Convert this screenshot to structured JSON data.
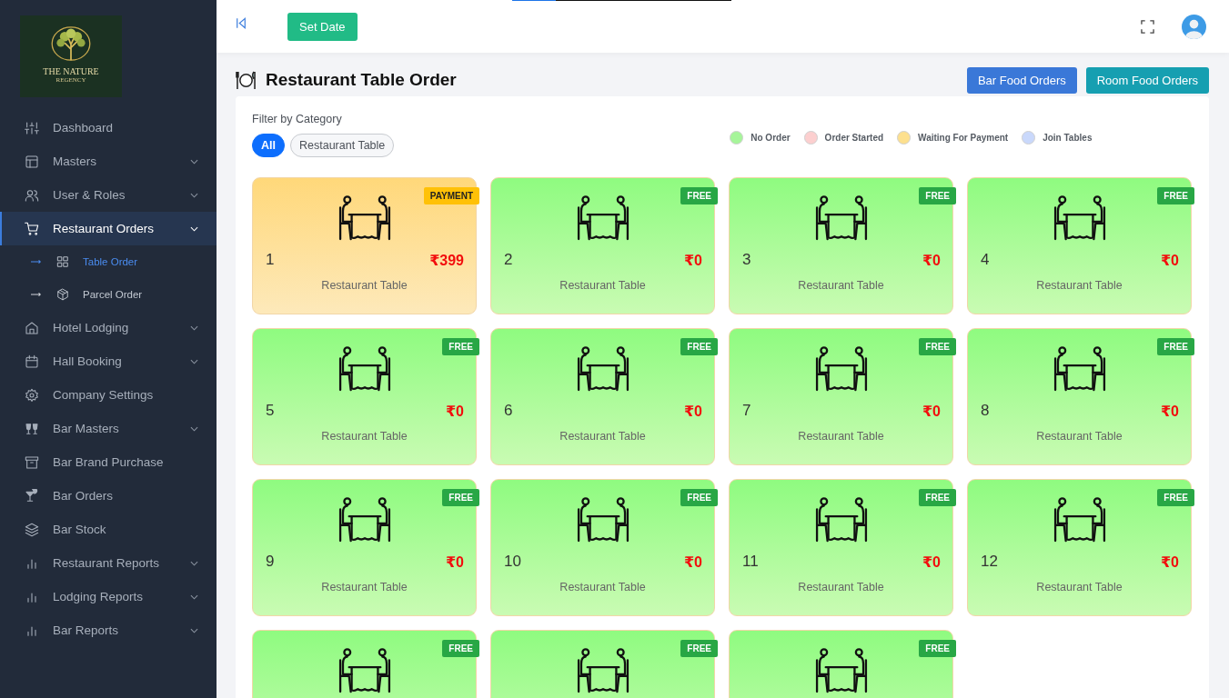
{
  "loading_bar": {
    "level": 0.2
  },
  "logo": {
    "name": "THE NATURE",
    "tagline": "REGENCY"
  },
  "sidebar": {
    "items": [
      {
        "label": "Dashboard",
        "expandable": false,
        "selected": false
      },
      {
        "label": "Masters",
        "expandable": true,
        "selected": false
      },
      {
        "label": "User & Roles",
        "expandable": true,
        "selected": false
      },
      {
        "label": "Restaurant Orders",
        "expandable": true,
        "selected": true,
        "children": [
          {
            "label": "Table Order",
            "selected": true
          },
          {
            "label": "Parcel Order",
            "selected": false
          }
        ]
      },
      {
        "label": "Hotel Lodging",
        "expandable": true,
        "selected": false
      },
      {
        "label": "Hall Booking",
        "expandable": true,
        "selected": false
      },
      {
        "label": "Company Settings",
        "expandable": false,
        "selected": false
      },
      {
        "label": "Bar Masters",
        "expandable": true,
        "selected": false
      },
      {
        "label": "Bar Brand Purchase",
        "expandable": false,
        "selected": false
      },
      {
        "label": "Bar Orders",
        "expandable": false,
        "selected": false
      },
      {
        "label": "Bar Stock",
        "expandable": false,
        "selected": false
      },
      {
        "label": "Restaurant Reports",
        "expandable": true,
        "selected": false
      },
      {
        "label": "Lodging Reports",
        "expandable": true,
        "selected": false
      },
      {
        "label": "Bar Reports",
        "expandable": true,
        "selected": false
      }
    ]
  },
  "header": {
    "set_date_button": "Set Date"
  },
  "page": {
    "title": "Restaurant Table Order",
    "buttons": [
      {
        "label": "Bar Food Orders",
        "kind": "primary"
      },
      {
        "label": "Room Food Orders",
        "kind": "info"
      }
    ]
  },
  "filter": {
    "label": "Filter by Category",
    "options": [
      {
        "label": "All",
        "selected": true
      },
      {
        "label": "Restaurant Table",
        "selected": false
      }
    ]
  },
  "legend": [
    {
      "label": "No Order",
      "color": "#a6f59a"
    },
    {
      "label": "Order Started",
      "color": "#fccfcf"
    },
    {
      "label": "Waiting For Payment",
      "color": "#fde08e"
    },
    {
      "label": "Join Tables",
      "color": "#c9d8fb"
    }
  ],
  "tables": [
    {
      "number": "1",
      "amount": "₹399",
      "category": "Restaurant Table",
      "kind": "payment",
      "badge": "PAYMENT"
    },
    {
      "number": "2",
      "amount": "₹0",
      "category": "Restaurant Table",
      "kind": "free",
      "badge": "FREE"
    },
    {
      "number": "3",
      "amount": "₹0",
      "category": "Restaurant Table",
      "kind": "free",
      "badge": "FREE"
    },
    {
      "number": "4",
      "amount": "₹0",
      "category": "Restaurant Table",
      "kind": "free",
      "badge": "FREE"
    },
    {
      "number": "5",
      "amount": "₹0",
      "category": "Restaurant Table",
      "kind": "free",
      "badge": "FREE"
    },
    {
      "number": "6",
      "amount": "₹0",
      "category": "Restaurant Table",
      "kind": "free",
      "badge": "FREE"
    },
    {
      "number": "7",
      "amount": "₹0",
      "category": "Restaurant Table",
      "kind": "free",
      "badge": "FREE"
    },
    {
      "number": "8",
      "amount": "₹0",
      "category": "Restaurant Table",
      "kind": "free",
      "badge": "FREE"
    },
    {
      "number": "9",
      "amount": "₹0",
      "category": "Restaurant Table",
      "kind": "free",
      "badge": "FREE"
    },
    {
      "number": "10",
      "amount": "₹0",
      "category": "Restaurant Table",
      "kind": "free",
      "badge": "FREE"
    },
    {
      "number": "11",
      "amount": "₹0",
      "category": "Restaurant Table",
      "kind": "free",
      "badge": "FREE"
    },
    {
      "number": "12",
      "amount": "₹0",
      "category": "Restaurant Table",
      "kind": "free",
      "badge": "FREE"
    },
    {
      "kind": "free",
      "badge": "FREE"
    },
    {
      "kind": "free",
      "badge": "FREE"
    },
    {
      "kind": "free",
      "badge": "FREE"
    }
  ]
}
